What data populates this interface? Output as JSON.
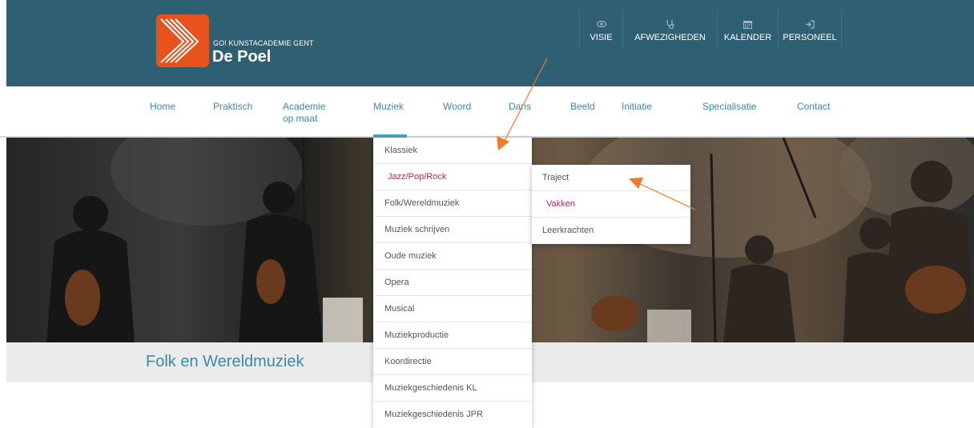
{
  "brand": {
    "subtitle": "GO! KUNSTACADEMIE GENT",
    "name": "De Poel",
    "logo_color": "#e8531b"
  },
  "top_nav": [
    {
      "label": "VISIE",
      "icon": "eye-icon"
    },
    {
      "label": "AFWEZIGHEDEN",
      "icon": "stethoscope-icon"
    },
    {
      "label": "KALENDER",
      "icon": "calendar-icon"
    },
    {
      "label": "PERSONEEL",
      "icon": "sign-in-icon"
    }
  ],
  "main_nav": {
    "home": "Home",
    "praktisch": "Praktisch",
    "academie_line1": "Academie",
    "academie_line2": "op maat",
    "muziek": "Muziek",
    "woord": "Woord",
    "dans": "Dans",
    "beeld": "Beeld",
    "initiatie": "Initiatie",
    "specialisatie": "Specialisatie",
    "contact": "Contact"
  },
  "dropdown": [
    "Klassiek",
    "Jazz/Pop/Rock",
    "Folk/Wereldmuziek",
    "Muziek schrijven",
    "Oude muziek",
    "Opera",
    "Musical",
    "Muziekproductie",
    "Koordirectie",
    "Muziekgeschiedenis KL",
    "Muziekgeschiedenis JPR"
  ],
  "submenu": [
    "Traject",
    "Vakken",
    "Leerkrachten"
  ],
  "page_title": "Folk en Wereldmuziek",
  "colors": {
    "header_bg": "#2f5f73",
    "link": "#3a8aa6",
    "highlight": "#c0245f",
    "annotation_arrow": "#f07a2a"
  }
}
